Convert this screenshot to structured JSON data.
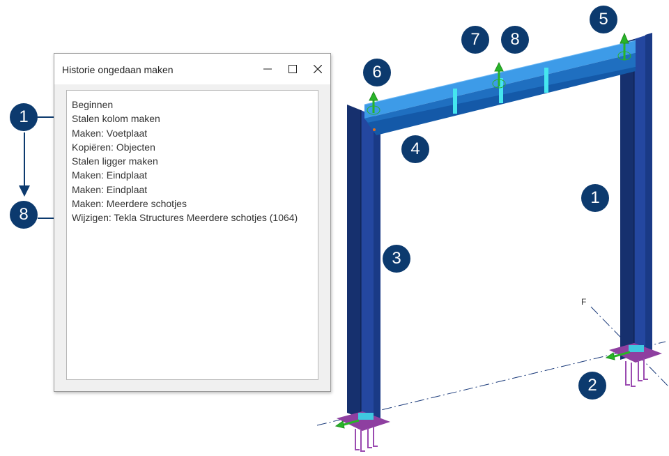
{
  "dialog": {
    "title": "Historie ongedaan maken",
    "buttons": [
      "minimize-icon",
      "maximize-icon",
      "close-icon"
    ],
    "items": [
      "Beginnen",
      "Stalen kolom maken",
      "Maken: Voetplaat",
      "Kopiëren: Objecten",
      "Stalen ligger maken",
      "Maken: Eindplaat",
      "Maken: Eindplaat",
      "Maken: Meerdere schotjes",
      "Wijzigen: Tekla Structures  Meerdere schotjes (1064)"
    ]
  },
  "callouts": {
    "list_first": "1",
    "list_last": "8",
    "model": [
      "1",
      "2",
      "3",
      "4",
      "5",
      "6",
      "7",
      "8"
    ]
  },
  "grid_label": "F",
  "colors": {
    "callout": "#0c3a6e",
    "column": "#1e3f8a",
    "beam": "#2c88d8",
    "plate": "#8e3fa0",
    "arrow": "#28b428"
  }
}
